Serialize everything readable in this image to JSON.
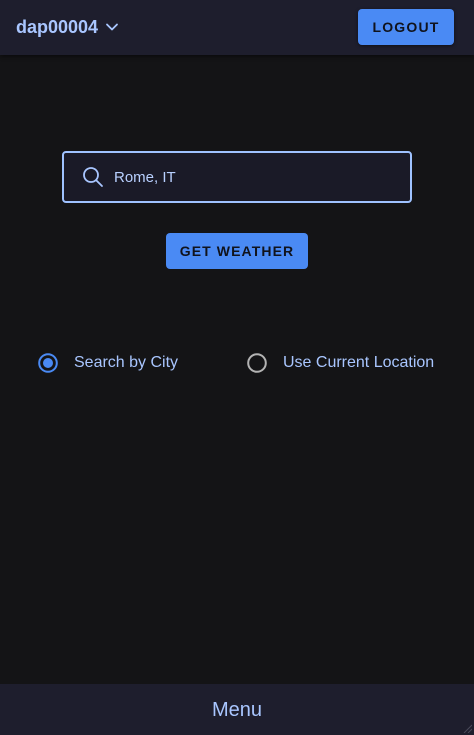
{
  "header": {
    "username": "dap00004",
    "user_menu_icon": "chevron-down-icon",
    "logout_label": "LOGOUT"
  },
  "search": {
    "value": "Rome, IT",
    "icon": "search-icon"
  },
  "actions": {
    "get_weather_label": "GET WEATHER"
  },
  "mode": {
    "options": [
      {
        "label": "Search by City",
        "selected": true
      },
      {
        "label": "Use Current Location",
        "selected": false
      }
    ]
  },
  "footer": {
    "menu_label": "Menu"
  },
  "colors": {
    "accent": "#4a8af4",
    "text_accent": "#a9c6ff",
    "background": "#141416",
    "bar": "#1e1e2d"
  }
}
